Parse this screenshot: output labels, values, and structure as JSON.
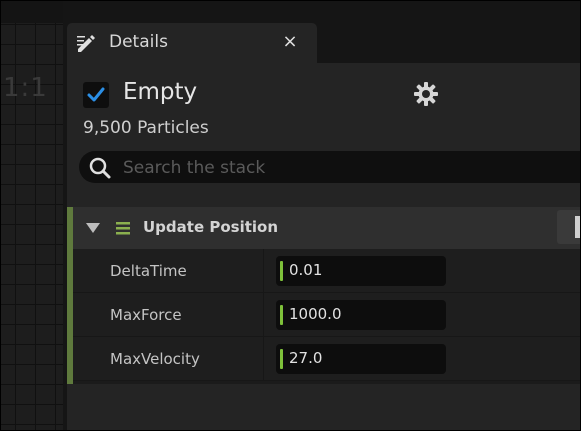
{
  "viewport": {
    "zoom_label": "1:1"
  },
  "tab": {
    "title": "Details",
    "close_label": "×"
  },
  "emitter": {
    "name": "Empty",
    "enabled": true,
    "particle_count": "9,500 Particles"
  },
  "search": {
    "placeholder": "Search the stack",
    "value": ""
  },
  "module": {
    "name": "Update Position",
    "accent_color": "#5f7a3d",
    "params": [
      {
        "label": "DeltaTime",
        "value": "0.01"
      },
      {
        "label": "MaxForce",
        "value": "1000.0"
      },
      {
        "label": "MaxVelocity",
        "value": "27.0"
      }
    ]
  },
  "icons": {
    "tab": "pencil-icon",
    "settings": "gear-icon",
    "search": "search-icon",
    "expander": "triangle-down-icon",
    "handle": "drag-handle-icon"
  }
}
